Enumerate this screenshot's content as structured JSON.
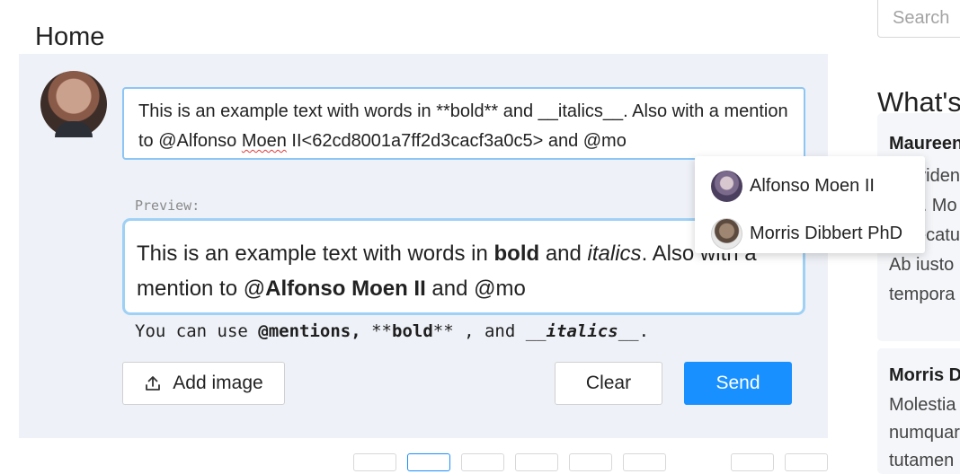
{
  "header": {
    "title": "Home"
  },
  "search": {
    "placeholder": "Search"
  },
  "composer": {
    "input_text": {
      "part1": "This is an example text with words in **bold** and __italics__. Also with a mention to @Alfonso ",
      "misspelled": "Moen",
      "part2": " II<62cd8001a7ff2d3cacf3a0c5> and @mo"
    },
    "preview_label": "Preview:",
    "preview": {
      "t1": "This is an example text with words in ",
      "bold": "bold",
      "t2": " and ",
      "italic": "italics",
      "t3": ". Also with a mention to @",
      "mention": "Alfonso Moen II",
      "t4": " and @mo"
    },
    "hint": {
      "t1": "You can use ",
      "mentions": "@mentions,",
      "t2": " **",
      "bold": "bold",
      "t3": "** , and __",
      "italics": "italics",
      "t4": "__."
    },
    "add_image_label": "Add image",
    "clear_label": "Clear",
    "send_label": "Send"
  },
  "mention_suggestions": [
    {
      "name": "Alfonso Moen II"
    },
    {
      "name": "Morris Dibbert PhD"
    }
  ],
  "sidebar": {
    "title": "What's",
    "cards": [
      {
        "author": "Maureen",
        "lines": [
          "Providen",
          "ipse. Mo",
          "Delecatu",
          "Ab iusto",
          "tempora"
        ]
      },
      {
        "author": "Morris D",
        "lines": [
          "Molestia",
          "numquar",
          "tutamen"
        ]
      }
    ]
  },
  "colors": {
    "accent": "#1890ff",
    "focus_border": "#8cc6f5",
    "composer_bg": "#eef1f7"
  },
  "icons": {
    "upload": "upload-icon"
  }
}
